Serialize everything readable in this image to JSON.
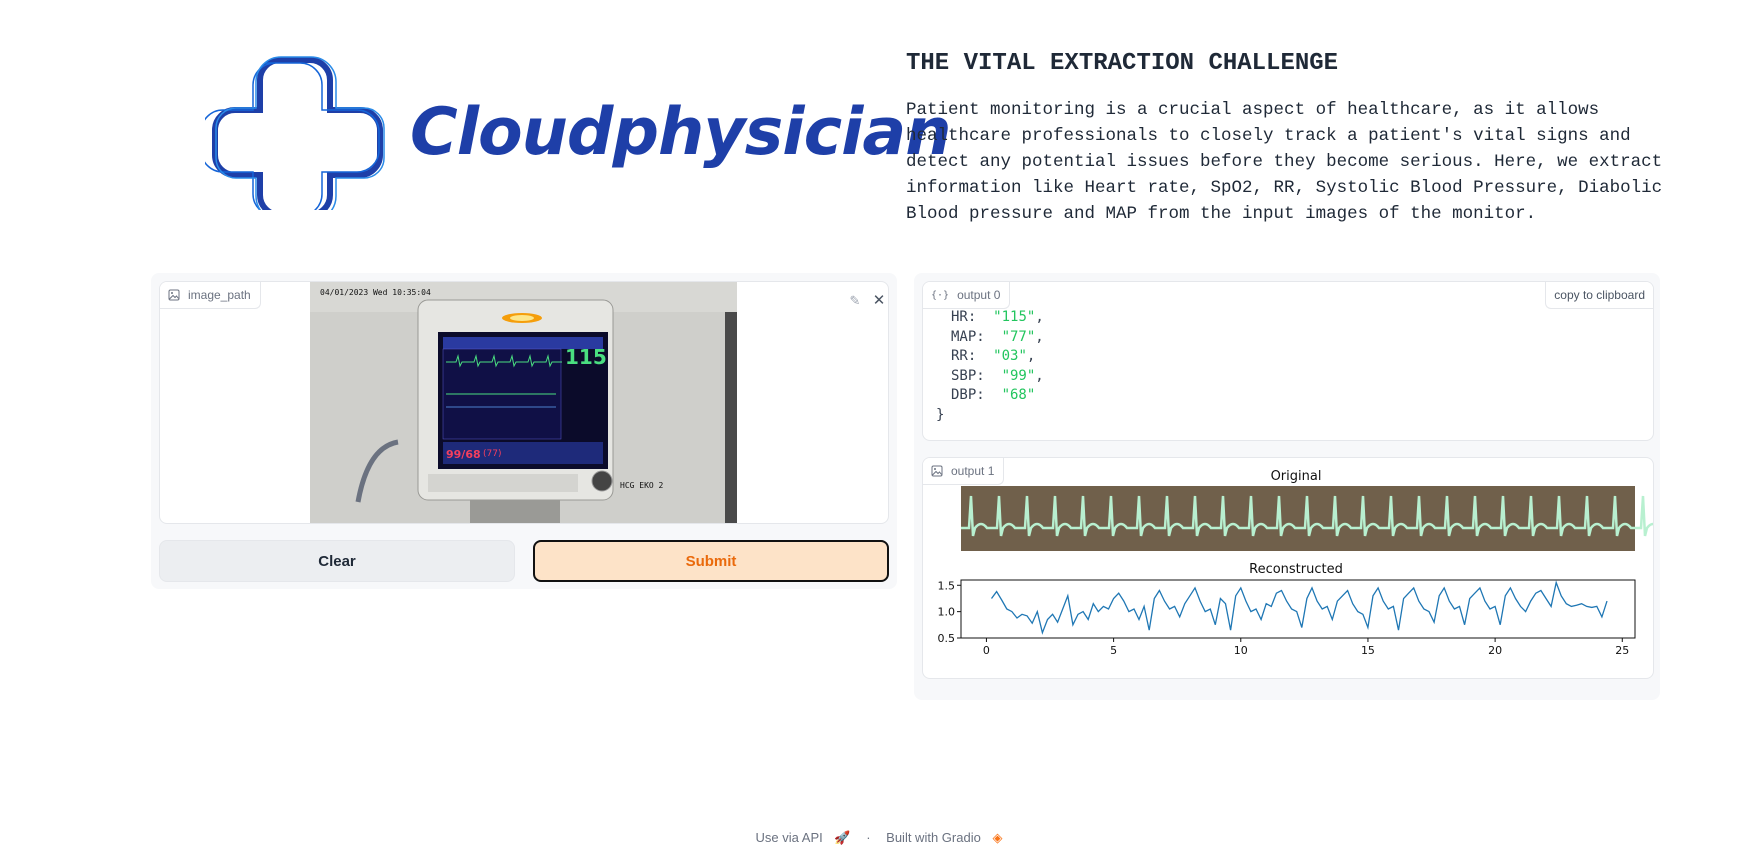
{
  "logo": {
    "text": "Cloudphysician"
  },
  "header": {
    "title": "THE VITAL EXTRACTION CHALLENGE",
    "description": "Patient monitoring is a crucial aspect of healthcare, as it allows healthcare professionals to closely track a patient's vital signs and detect any potential issues before they become serious. Here, we extract information like Heart rate, SpO2, RR, Systolic Blood Pressure, Diabolic Blood pressure and MAP from the input images of the monitor."
  },
  "input": {
    "label": "image_path",
    "monitor": {
      "timestamp": "04/01/2023 Wed 10:35:04",
      "hr_value": "115",
      "bp_value": "99/68",
      "map_value": "(77)",
      "caption": "HCG EKO 2"
    }
  },
  "buttons": {
    "clear": "Clear",
    "submit": "Submit"
  },
  "output0": {
    "label": "output 0",
    "copy": "copy to clipboard",
    "open_brace": "{",
    "close_brace": "}",
    "rows": [
      {
        "key": "HR:",
        "value": "\"115\"",
        "sep": ","
      },
      {
        "key": "MAP:",
        "value": "\"77\"",
        "sep": ","
      },
      {
        "key": "RR:",
        "value": "\"03\"",
        "sep": ","
      },
      {
        "key": "SBP:",
        "value": "\"99\"",
        "sep": ","
      },
      {
        "key": "DBP:",
        "value": "\"68\"",
        "sep": ""
      }
    ]
  },
  "output1": {
    "label": "output 1",
    "original_title": "Original",
    "reconstructed_title": "Reconstructed"
  },
  "chart_data": {
    "type": "line",
    "title": "Reconstructed",
    "xlim": [
      -1,
      25.5
    ],
    "ylim": [
      0.5,
      1.6
    ],
    "xticks": [
      0,
      5,
      10,
      15,
      20,
      25
    ],
    "yticks": [
      0.5,
      1.0,
      1.5
    ],
    "color": "#1f77b4",
    "x": [
      0.2,
      0.4,
      0.6,
      0.8,
      1.0,
      1.2,
      1.4,
      1.6,
      1.8,
      2.0,
      2.2,
      2.4,
      2.6,
      2.8,
      3.0,
      3.2,
      3.4,
      3.6,
      3.8,
      4.0,
      4.2,
      4.4,
      4.6,
      4.8,
      5.0,
      5.2,
      5.4,
      5.6,
      5.8,
      6.0,
      6.2,
      6.4,
      6.6,
      6.8,
      7.0,
      7.2,
      7.4,
      7.6,
      7.8,
      8.0,
      8.2,
      8.4,
      8.6,
      8.8,
      9.0,
      9.2,
      9.4,
      9.6,
      9.8,
      10.0,
      10.2,
      10.4,
      10.6,
      10.8,
      11.0,
      11.2,
      11.4,
      11.6,
      11.8,
      12.0,
      12.2,
      12.4,
      12.6,
      12.8,
      13.0,
      13.2,
      13.4,
      13.6,
      13.8,
      14.0,
      14.2,
      14.4,
      14.6,
      14.8,
      15.0,
      15.2,
      15.4,
      15.6,
      15.8,
      16.0,
      16.2,
      16.4,
      16.6,
      16.8,
      17.0,
      17.2,
      17.4,
      17.6,
      17.8,
      18.0,
      18.2,
      18.4,
      18.6,
      18.8,
      19.0,
      19.2,
      19.4,
      19.6,
      19.8,
      20.0,
      20.2,
      20.4,
      20.6,
      20.8,
      21.0,
      21.2,
      21.4,
      21.6,
      21.8,
      22.0,
      22.2,
      22.4,
      22.6,
      22.8,
      23.0,
      23.2,
      23.4,
      23.6,
      23.8,
      24.0,
      24.2,
      24.4,
      24.6,
      24.8
    ],
    "y": [
      1.25,
      1.38,
      1.22,
      1.05,
      1.0,
      0.88,
      0.95,
      0.92,
      0.78,
      1.0,
      0.6,
      0.85,
      0.95,
      0.8,
      1.05,
      1.3,
      0.75,
      0.95,
      1.0,
      0.85,
      1.15,
      1.0,
      1.1,
      1.05,
      1.25,
      1.35,
      1.2,
      1.0,
      1.05,
      0.85,
      1.1,
      0.65,
      1.25,
      1.4,
      1.2,
      1.05,
      1.1,
      0.9,
      1.15,
      1.3,
      1.45,
      1.2,
      1.0,
      1.05,
      0.75,
      1.25,
      1.15,
      0.65,
      1.3,
      1.45,
      1.2,
      1.0,
      1.05,
      0.85,
      1.15,
      1.1,
      1.35,
      1.4,
      1.2,
      1.05,
      1.0,
      0.7,
      1.25,
      1.45,
      1.2,
      1.05,
      1.1,
      0.85,
      1.2,
      1.3,
      1.4,
      1.15,
      1.0,
      0.95,
      0.7,
      1.3,
      1.45,
      1.2,
      1.05,
      1.1,
      0.65,
      1.25,
      1.35,
      1.45,
      1.2,
      1.05,
      1.0,
      0.8,
      1.3,
      1.45,
      1.2,
      1.05,
      1.1,
      0.75,
      1.25,
      1.35,
      1.45,
      1.2,
      1.05,
      1.1,
      0.75,
      1.3,
      1.45,
      1.25,
      1.1,
      1.0,
      1.2,
      1.35,
      1.4,
      1.25,
      1.1,
      1.55,
      1.3,
      1.15,
      1.1,
      1.12,
      1.15,
      1.1,
      1.08,
      1.1,
      0.9,
      1.2
    ]
  },
  "footer": {
    "api": "Use via API",
    "built": "Built with Gradio",
    "separator": "·"
  }
}
